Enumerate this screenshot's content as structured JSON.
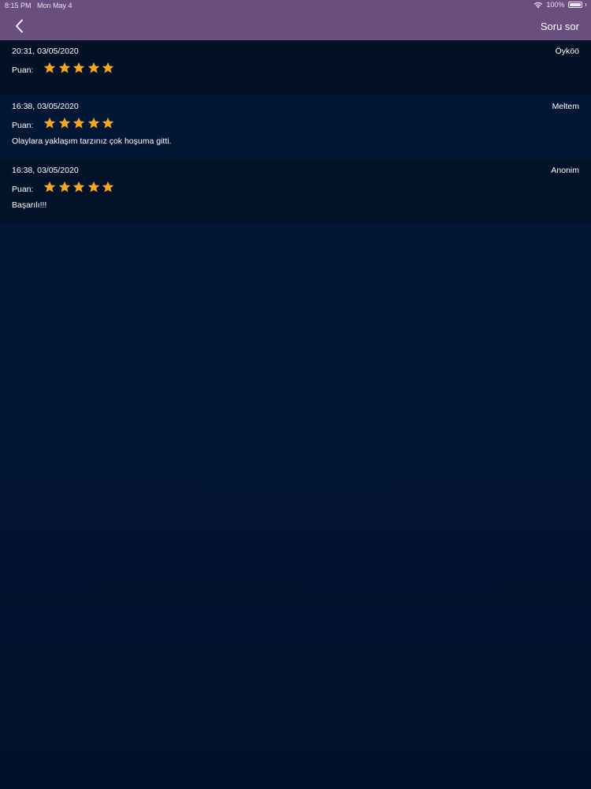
{
  "status_bar": {
    "time": "8:15 PM",
    "date": "Mon May 4",
    "battery": "100%"
  },
  "header": {
    "action_label": "Soru sor",
    "back_icon": "chevron-left-icon"
  },
  "colors": {
    "header": "#6a4f7e",
    "background": "#021433",
    "star": "#f5a623"
  },
  "reviews": [
    {
      "date": "20:31, 03/05/2020",
      "author": "Öyköö",
      "rating_label": "Puan:",
      "rating": 5,
      "max_rating": 5,
      "text": ""
    },
    {
      "date": "16:38, 03/05/2020",
      "author": "Meltem",
      "rating_label": "Puan:",
      "rating": 5,
      "max_rating": 5,
      "text": "Olaylara yaklaşım tarzınız çok hoşuma gitti."
    },
    {
      "date": "16:38, 03/05/2020",
      "author": "Anonim",
      "rating_label": "Puan:",
      "rating": 5,
      "max_rating": 5,
      "text": "Başarılı!!!"
    }
  ]
}
